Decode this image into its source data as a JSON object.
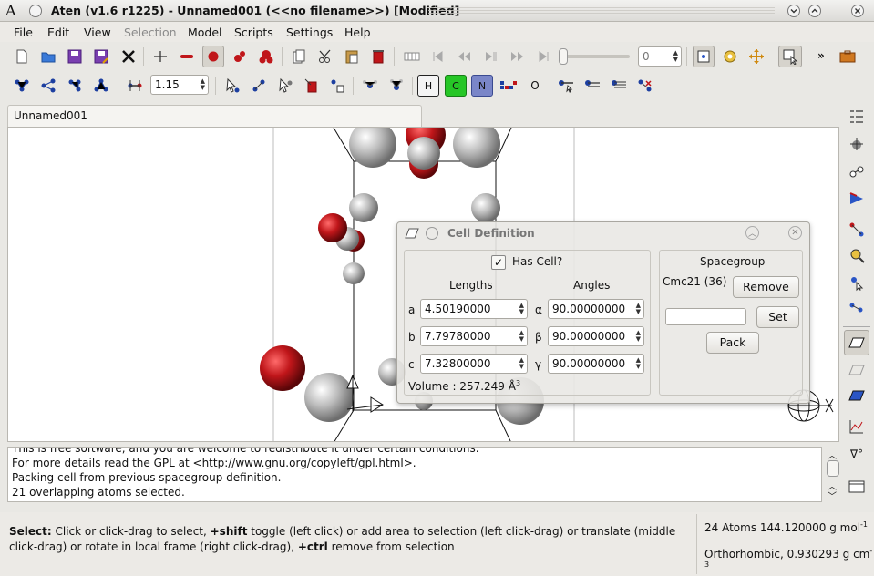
{
  "window": {
    "title": "Aten (v1.6 r1225) - Unnamed001 (<<no filename>>) [Modified]"
  },
  "menu": [
    "File",
    "Edit",
    "View",
    "Selection",
    "Model",
    "Scripts",
    "Settings",
    "Help"
  ],
  "toolbar": {
    "frame_value": "0",
    "bond_tolerance": "1.15",
    "elements": {
      "h": "H",
      "c": "C",
      "n": "N",
      "o": "O"
    }
  },
  "tab": {
    "label": "Unnamed001"
  },
  "messages": [
    "This is free software, and you are welcome to redistribute it under certain conditions.",
    "For more details read the GPL at <http://www.gnu.org/copyleft/gpl.html>.",
    "Packing cell from previous spacegroup definition.",
    "21 overlapping atoms selected."
  ],
  "status": {
    "hint_label": "Select:",
    "hint_part1": " Click or click-drag to select, ",
    "hint_shift": "+shift",
    "hint_part2": " toggle (left click) or add area to selection (left click-drag) or translate (middle click-drag) or rotate in local frame (right click-drag), ",
    "hint_ctrl": "+ctrl",
    "hint_part3": " remove from selection",
    "atoms_text": "24 Atoms 144.120000 g mol",
    "atoms_sup": "-1",
    "cell_text": "Orthorhombic, 0.930293 g cm",
    "cell_sup": "-3"
  },
  "cell_dialog": {
    "title": "Cell Definition",
    "has_cell_label": "Has Cell?",
    "has_cell": true,
    "lengths_header": "Lengths",
    "angles_header": "Angles",
    "a_label": "a",
    "a_value": "4.50190000",
    "b_label": "b",
    "b_value": "7.79780000",
    "c_label": "c",
    "c_value": "7.32800000",
    "alpha_label": "α",
    "alpha_value": "90.00000000",
    "beta_label": "β",
    "beta_value": "90.00000000",
    "gamma_label": "γ",
    "gamma_value": "90.00000000",
    "volume": "Volume : 257.249 Å",
    "volume_sup": "3",
    "spacegroup_header": "Spacegroup",
    "spacegroup_value": "Cmc21 (36)",
    "remove_label": "Remove",
    "set_label": "Set",
    "pack_label": "Pack",
    "spacegroup_input": ""
  },
  "colors": {
    "oxygen": "#c0161a",
    "carbon": "#bdbdbd",
    "accent": "#2a55c5"
  }
}
